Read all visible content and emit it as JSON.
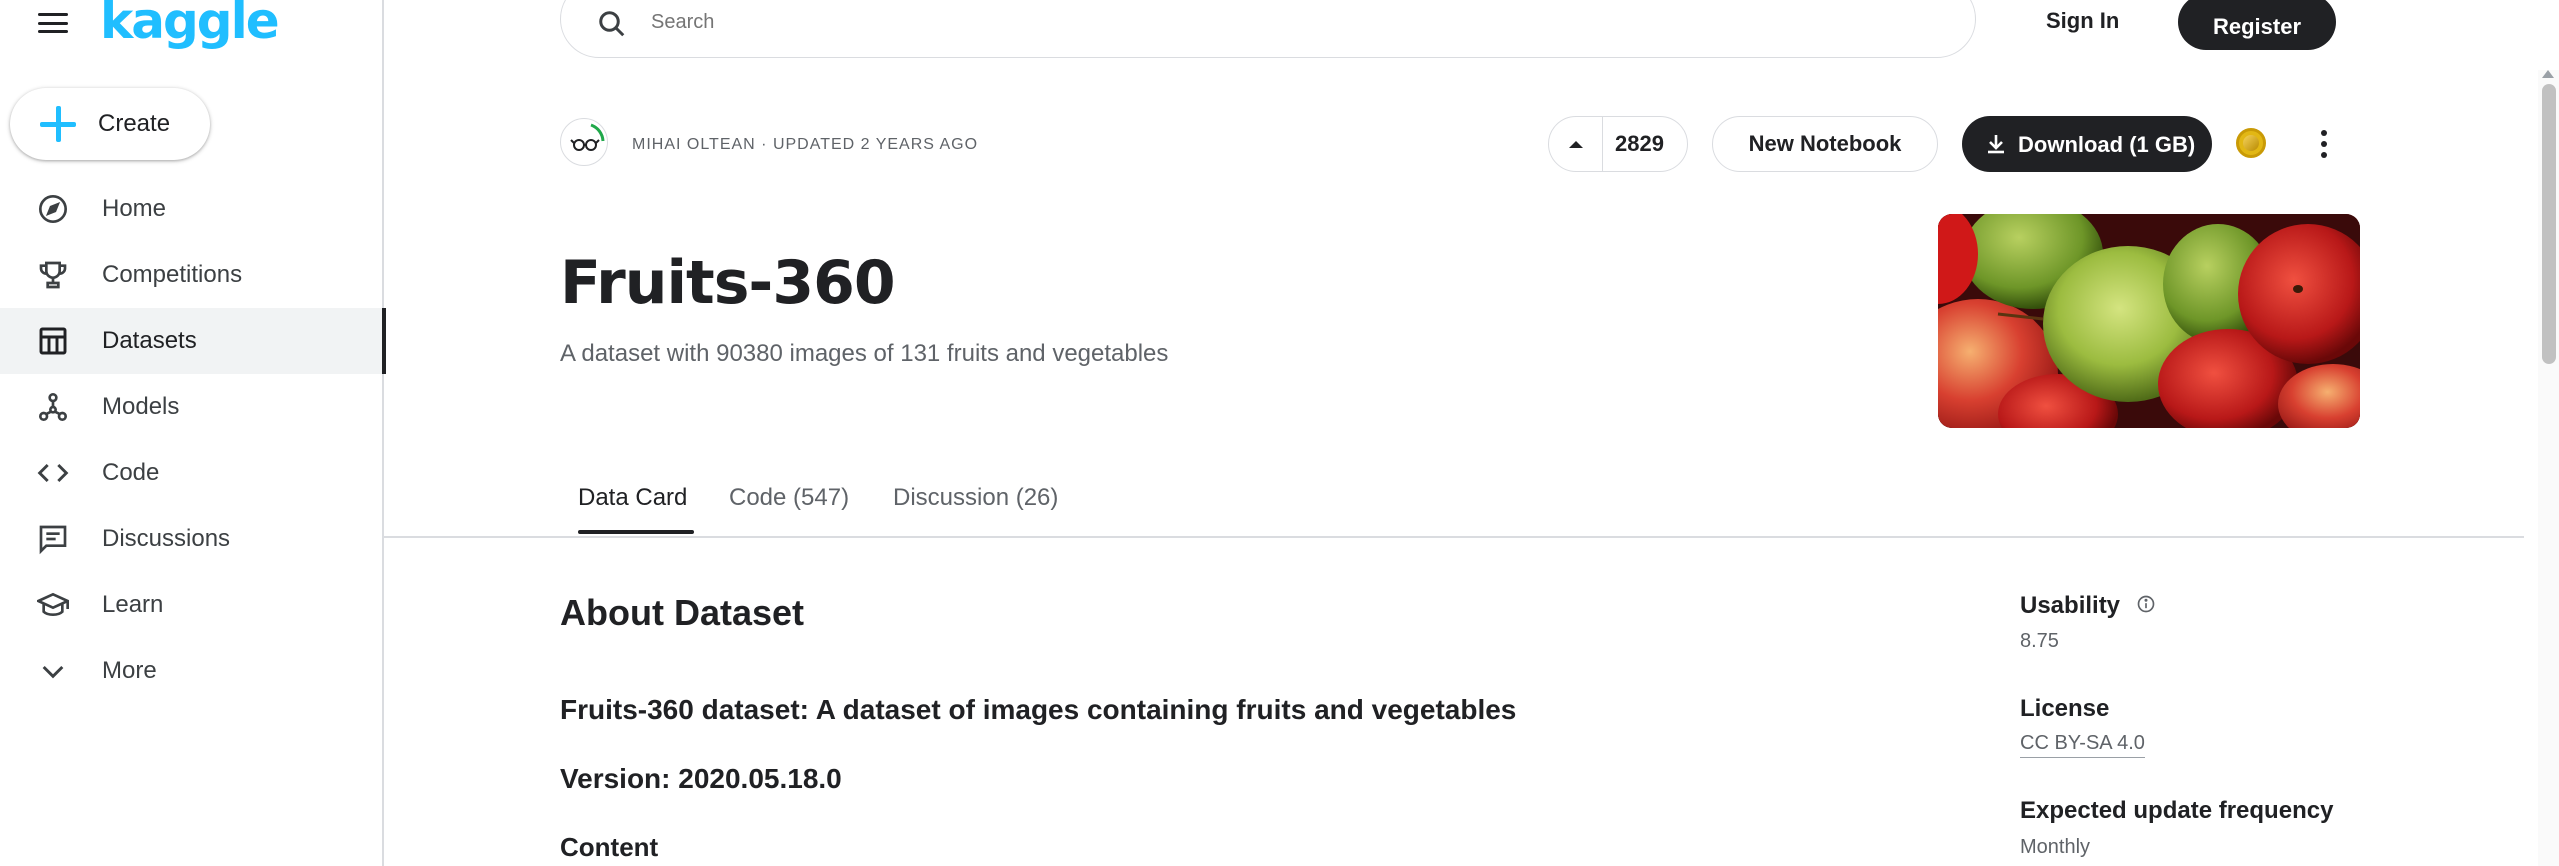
{
  "brand": {
    "logo_text": "kaggle",
    "accent": "#20beff"
  },
  "sidebar": {
    "create_label": "Create",
    "items": [
      {
        "label": "Home",
        "icon": "compass-icon",
        "active": false
      },
      {
        "label": "Competitions",
        "icon": "trophy-icon",
        "active": false
      },
      {
        "label": "Datasets",
        "icon": "table-icon",
        "active": true
      },
      {
        "label": "Models",
        "icon": "models-icon",
        "active": false
      },
      {
        "label": "Code",
        "icon": "code-icon",
        "active": false
      },
      {
        "label": "Discussions",
        "icon": "discussion-icon",
        "active": false
      },
      {
        "label": "Learn",
        "icon": "graduation-cap-icon",
        "active": false
      },
      {
        "label": "More",
        "icon": "chevron-down-icon",
        "active": false
      }
    ]
  },
  "topbar": {
    "search_placeholder": "Search",
    "sign_in": "Sign In",
    "register": "Register"
  },
  "dataset": {
    "author_meta": "MIHAI OLTEAN · UPDATED 2 YEARS AGO",
    "upvotes": "2829",
    "new_notebook": "New Notebook",
    "download": "Download (1 GB)",
    "title": "Fruits-360",
    "subtitle": "A dataset with 90380 images of 131 fruits and vegetables"
  },
  "tabs": [
    {
      "label": "Data Card",
      "active": true
    },
    {
      "label": "Code (547)",
      "active": false
    },
    {
      "label": "Discussion (26)",
      "active": false
    }
  ],
  "content": {
    "about_title": "About Dataset",
    "heading1": "Fruits-360 dataset: A dataset of images containing fruits and vegetables",
    "heading2": "Version: 2020.05.18.0",
    "heading3": "Content"
  },
  "side_panel": {
    "usability_label": "Usability",
    "usability_value": "8.75",
    "license_label": "License",
    "license_value": "CC BY-SA 4.0",
    "update_label": "Expected update frequency",
    "update_value": "Monthly"
  }
}
